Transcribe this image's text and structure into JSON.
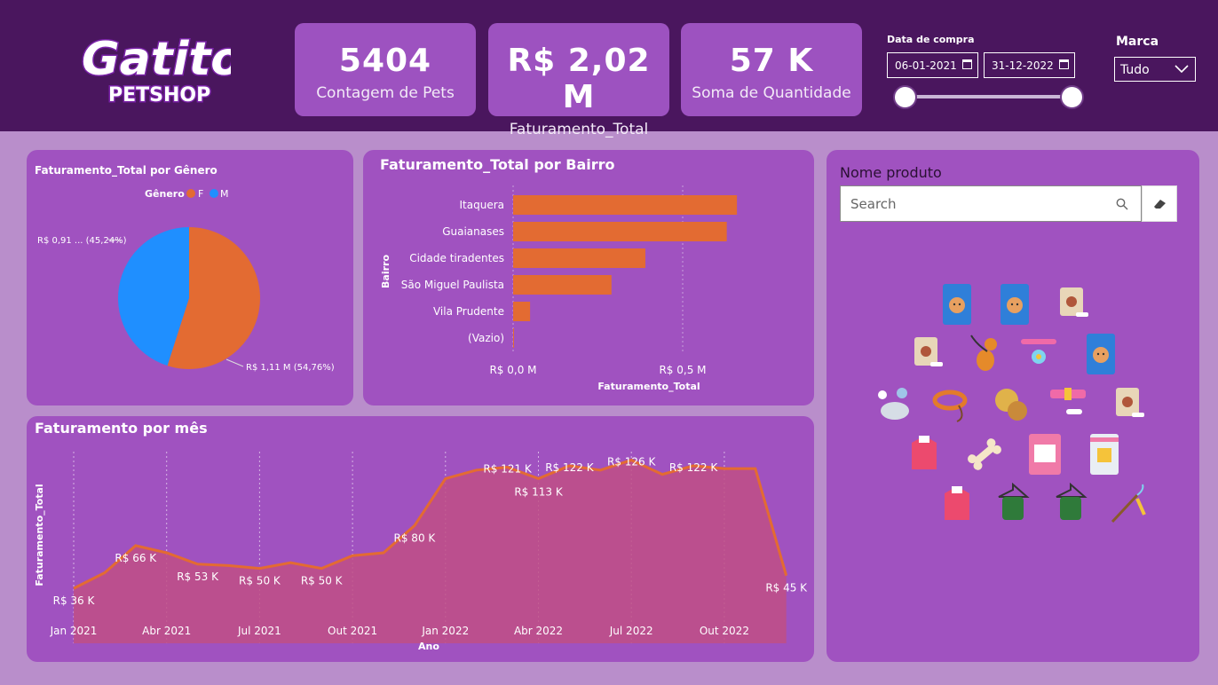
{
  "header": {
    "logo_main": "Gatito",
    "logo_sub": "PETSHOP",
    "kpis": [
      {
        "value": "5404",
        "label": "Contagem de Pets"
      },
      {
        "value": "R$ 2,02 M",
        "label": "Faturamento_Total"
      },
      {
        "value": "57 K",
        "label": "Soma de Quantidade"
      }
    ],
    "date_filter": {
      "title": "Data de compra",
      "start": "06-01-2021",
      "end": "31-12-2022"
    },
    "brand_filter": {
      "title": "Marca",
      "selected": "Tudo"
    }
  },
  "colors": {
    "female": "#e36b32",
    "male": "#1f8fff",
    "bar": "#e36b32",
    "area_line": "#e36b32",
    "area_fill": "#c04f85",
    "header": "#4a165e",
    "panel": "#a052c0"
  },
  "pie": {
    "title": "Faturamento_Total por Gênero",
    "legend_title": "Gênero",
    "legend": [
      "F",
      "M"
    ],
    "label_m": "R$ 0,91 ... (45,24%)",
    "label_f": "R$ 1,11 M (54,76%)"
  },
  "bar": {
    "title": "Faturamento_Total por Bairro",
    "y_label": "Bairro",
    "x_label": "Faturamento_Total",
    "ticks": [
      "R$ 0,0 M",
      "R$ 0,5 M"
    ]
  },
  "line": {
    "title": "Faturamento por mês",
    "y_label": "Faturamento_Total",
    "x_label": "Ano",
    "data_labels": [
      "R$ 36 K",
      "R$ 66 K",
      "R$ 53 K",
      "R$ 50 K",
      "R$ 50 K",
      "R$ 80 K",
      "R$ 121 K",
      "R$ 113 K",
      "R$ 122 K",
      "R$ 126 K",
      "R$ 122 K",
      "R$ 45 K"
    ]
  },
  "products": {
    "title": "Nome produto",
    "search_placeholder": "Search"
  },
  "chart_data": [
    {
      "type": "pie",
      "title": "Faturamento_Total por Gênero",
      "categories": [
        "F",
        "M"
      ],
      "values": [
        1.11,
        0.91
      ],
      "percent": [
        54.76,
        45.24
      ],
      "legend": "top"
    },
    {
      "type": "bar",
      "orientation": "horizontal",
      "title": "Faturamento_Total por Bairro",
      "categories": [
        "Itaquera",
        "Guaianases",
        "Cidade tiradentes",
        "São Miguel Paulista",
        "Vila Prudente",
        "(Vazio)"
      ],
      "values": [
        0.66,
        0.63,
        0.39,
        0.29,
        0.05,
        0.0
      ],
      "xlabel": "Faturamento_Total",
      "ylabel": "Bairro",
      "xlim": [
        0,
        0.8
      ],
      "grid": true
    },
    {
      "type": "area",
      "title": "Faturamento por mês",
      "x": [
        "Jan 2021",
        "Fev 2021",
        "Mar 2021",
        "Abr 2021",
        "Mai 2021",
        "Jun 2021",
        "Jul 2021",
        "Ago 2021",
        "Set 2021",
        "Out 2021",
        "Nov 2021",
        "Dez 2021",
        "Jan 2022",
        "Fev 2022",
        "Mar 2022",
        "Abr 2022",
        "Mai 2022",
        "Jun 2022",
        "Jul 2022",
        "Ago 2022",
        "Set 2022",
        "Out 2022",
        "Nov 2022",
        "Dez 2022"
      ],
      "values": [
        36,
        47,
        66,
        61,
        53,
        52,
        50,
        54,
        50,
        59,
        61,
        80,
        113,
        119,
        121,
        113,
        122,
        119,
        126,
        116,
        122,
        120,
        120,
        45
      ],
      "tick_labels": [
        "Jan 2021",
        "Abr 2021",
        "Jul 2021",
        "Out 2021",
        "Jan 2022",
        "Abr 2022",
        "Jul 2022",
        "Out 2022"
      ],
      "xlabel": "Ano",
      "ylabel": "Faturamento_Total",
      "ylim": [
        0,
        140
      ],
      "grid": true
    }
  ]
}
